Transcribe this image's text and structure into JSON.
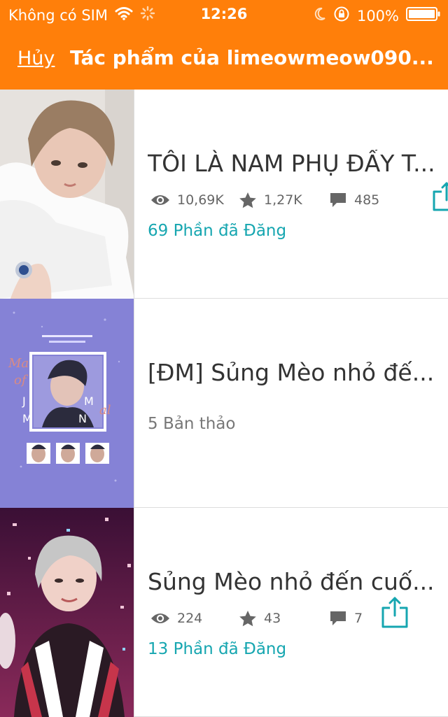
{
  "status_bar": {
    "carrier": "Không có SIM",
    "time": "12:26",
    "battery": "100%",
    "icons": [
      "wifi-icon",
      "loading-spinner-icon",
      "moon-icon",
      "rotation-lock-icon",
      "battery-icon"
    ]
  },
  "header": {
    "cancel_label": "Hủy",
    "title": "Tác phẩm của limeowmeow090..."
  },
  "colors": {
    "accent": "#ff7f0a",
    "teal": "#16a6b0",
    "title_text": "#333333",
    "meta_text": "#666666"
  },
  "stories": [
    {
      "title": "TÔI LÀ NAM PHỤ ĐẤY T...",
      "views": "10,69K",
      "votes": "1,27K",
      "comments": "485",
      "status": "69 Phần đã Đăng",
      "cover_palette": [
        "#e4e0dc",
        "#ffffff",
        "#9a7d63",
        "#e9c7b6"
      ]
    },
    {
      "title": "[ĐM] Sủng Mèo nhỏ đế...",
      "status": "5 Bản thảo",
      "cover_palette": [
        "#8582d6",
        "#ffffff",
        "#2b2b3d",
        "#d98a84"
      ]
    },
    {
      "title": "Sủng Mèo nhỏ đến cuố...",
      "views": "224",
      "votes": "43",
      "comments": "7",
      "status": "13 Phần đã Đăng",
      "cover_palette": [
        "#5f1c4f",
        "#c6c6c6",
        "#c7354b",
        "#f0d1c8"
      ]
    }
  ]
}
